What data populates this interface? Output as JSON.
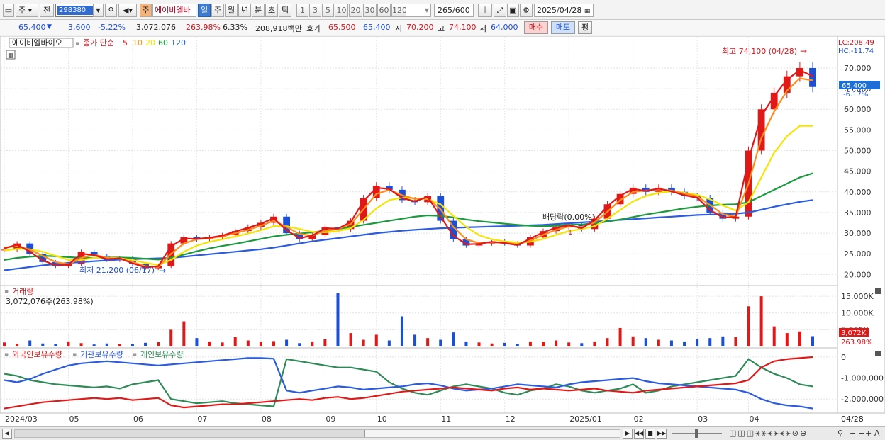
{
  "toolbar": {
    "market": "주",
    "prev_label": "전",
    "code": "298380",
    "stock_tag": "주",
    "stock_name": "에이비엘바",
    "periods": [
      "일",
      "주",
      "월",
      "년",
      "분",
      "초",
      "틱"
    ],
    "active_period": "일",
    "intervals": [
      "1",
      "3",
      "5",
      "10",
      "20",
      "30",
      "60",
      "120"
    ],
    "count": "265",
    "count_max": "/600",
    "date": "2025/04/28"
  },
  "quote": {
    "price": "65,400",
    "change": "3,600",
    "change_pct": "-5.22%",
    "volume": "3,072,076",
    "vol_ratio": "263.98%",
    "turnover_pct": "6.33%",
    "amount": "208,918백만",
    "bid_label": "호가",
    "ask_price": "65,500",
    "bid_price": "65,400",
    "open_label": "시",
    "open": "70,200",
    "high_label": "고",
    "high": "74,100",
    "low_label": "저",
    "low": "64,000",
    "buy_label": "매수",
    "sell_label": "매도",
    "flat_label": "평"
  },
  "price_panel": {
    "stock_label": "에이비엘바이오",
    "ma_title": "종가 단순",
    "ma_periods": [
      "5",
      "10",
      "20",
      "60",
      "120"
    ],
    "ma_colors": [
      "#e01818",
      "#ff8c1a",
      "#f5e400",
      "#1a9a3c",
      "#2a5be0"
    ],
    "lc": "LC:208.49",
    "hc": "HC:-11.74",
    "high_note": "최고 74,100 (04/28)",
    "low_note": "최저 21,200 (06/17)",
    "dividend_note": "배당락(0.00%)",
    "price_tag": "65,400",
    "pct_tag": "-6.17%",
    "y_labels": [
      "70,000",
      "65,000",
      "60,000",
      "55,000",
      "50,000",
      "45,000",
      "40,000",
      "35,000",
      "30,000",
      "25,000",
      "20,000"
    ]
  },
  "volume_panel": {
    "title": "거래량",
    "value": "3,072,076주(263.98%)",
    "y_labels": [
      "15,000K",
      "10,000K",
      "5,000K"
    ],
    "tag": "3,072K",
    "tag_pct": "263.98%"
  },
  "holding_panel": {
    "series_labels": [
      "외국인보유수량",
      "기관보유수량",
      "개인보유수량"
    ],
    "series_colors": [
      "#e01818",
      "#2a5be0",
      "#2e8b57"
    ],
    "y_labels": [
      "0",
      "-1,000,000",
      "-2,000,000"
    ]
  },
  "x_axis": {
    "labels": [
      "2024/03",
      "05",
      "06",
      "07",
      "08",
      "09",
      "10",
      "11",
      "12",
      "2025/01",
      "02",
      "03",
      "04"
    ],
    "right_label": "04/28"
  },
  "chart_data": {
    "type": "line",
    "title": "에이비엘바이오",
    "ylim": [
      18000,
      76000
    ],
    "months": [
      "2024/03",
      "05",
      "06",
      "07",
      "08",
      "09",
      "10",
      "11",
      "12",
      "2025/01",
      "02",
      "03",
      "04"
    ],
    "close": [
      26000,
      27500,
      25000,
      23000,
      22000,
      22500,
      25500,
      24500,
      23500,
      24000,
      22500,
      21500,
      22000,
      27500,
      29000,
      28500,
      29000,
      29500,
      30500,
      31500,
      32500,
      34000,
      30000,
      28500,
      29500,
      31500,
      31000,
      33000,
      38500,
      41500,
      40500,
      38000,
      37500,
      39000,
      33000,
      28500,
      27000,
      27500,
      28000,
      27500,
      27000,
      29000,
      30500,
      31500,
      32000,
      31000,
      33500,
      37000,
      39500,
      41000,
      40000,
      41000,
      40000,
      39000,
      38500,
      35000,
      33500,
      34000,
      50000,
      60000,
      64000,
      68000,
      70000,
      65400
    ],
    "series": [
      {
        "name": "5",
        "values": [
          26300,
          27200,
          25500,
          23400,
          22200,
          22400,
          25000,
          24700,
          23700,
          23900,
          22700,
          21700,
          22000,
          26800,
          28700,
          28600,
          28900,
          29400,
          30400,
          31300,
          32300,
          33600,
          30700,
          28800,
          29400,
          31200,
          31100,
          32700,
          37800,
          41000,
          40700,
          38500,
          37700,
          38800,
          34000,
          29400,
          27300,
          27400,
          27900,
          27600,
          27100,
          28700,
          30200,
          31300,
          31900,
          31200,
          33100,
          36500,
          39100,
          40700,
          40200,
          40800,
          40100,
          39200,
          38600,
          35600,
          33800,
          33900,
          47800,
          58400,
          63200,
          67200,
          69500,
          68000
        ]
      },
      {
        "name": "10",
        "values": [
          26500,
          26900,
          26000,
          24500,
          23000,
          22500,
          24000,
          24800,
          24000,
          23800,
          23000,
          22000,
          21800,
          25000,
          27500,
          28500,
          28800,
          29200,
          30000,
          30800,
          31800,
          33000,
          31500,
          29800,
          29400,
          30600,
          31000,
          32200,
          35800,
          39500,
          40500,
          39200,
          38300,
          38500,
          35800,
          31500,
          28500,
          27600,
          27800,
          27700,
          27300,
          28200,
          29600,
          30800,
          31600,
          31500,
          32600,
          35200,
          38000,
          40000,
          40300,
          40600,
          40300,
          39600,
          38900,
          36800,
          34600,
          34000,
          42000,
          53000,
          59500,
          64500,
          67500,
          67000
        ]
      },
      {
        "name": "20",
        "values": [
          25800,
          26200,
          26100,
          25500,
          24500,
          23500,
          23500,
          24000,
          24100,
          23900,
          23500,
          22800,
          22300,
          23500,
          25500,
          27000,
          27900,
          28500,
          29200,
          29900,
          30700,
          31700,
          31700,
          31000,
          30300,
          30200,
          30500,
          31200,
          33200,
          36000,
          38000,
          38600,
          38400,
          38300,
          37000,
          34200,
          31500,
          29500,
          28500,
          28000,
          27700,
          27900,
          28600,
          29600,
          30500,
          31000,
          31700,
          33500,
          35600,
          37700,
          39000,
          39800,
          40100,
          39800,
          39300,
          38200,
          36700,
          35500,
          37500,
          43500,
          49500,
          53500,
          56000,
          56000
        ]
      },
      {
        "name": "60",
        "values": [
          23500,
          24000,
          24300,
          24500,
          24400,
          24200,
          24000,
          24000,
          24100,
          24100,
          24000,
          23800,
          23600,
          24000,
          24800,
          25600,
          26300,
          26900,
          27400,
          28000,
          28600,
          29200,
          29600,
          29900,
          30200,
          30600,
          31000,
          31500,
          32000,
          32500,
          33000,
          33500,
          34000,
          34300,
          34200,
          33800,
          33300,
          32900,
          32600,
          32300,
          32000,
          31800,
          31700,
          31800,
          32000,
          32100,
          32400,
          32800,
          33300,
          33900,
          34500,
          35000,
          35500,
          36000,
          36400,
          36700,
          36900,
          37000,
          37500,
          39000,
          40500,
          42000,
          43500,
          44500
        ]
      },
      {
        "name": "120",
        "values": [
          21000,
          21400,
          21800,
          22200,
          22500,
          22800,
          23000,
          23200,
          23400,
          23600,
          23700,
          23800,
          23900,
          24000,
          24300,
          24600,
          24900,
          25200,
          25500,
          25800,
          26100,
          26500,
          27000,
          27500,
          28000,
          28400,
          28800,
          29200,
          29600,
          30000,
          30300,
          30600,
          30800,
          31000,
          31200,
          31300,
          31400,
          31500,
          31600,
          31700,
          31800,
          31900,
          32000,
          32200,
          32400,
          32600,
          32800,
          33000,
          33200,
          33400,
          33600,
          33800,
          34000,
          34200,
          34400,
          34500,
          34600,
          34700,
          35000,
          35700,
          36400,
          37000,
          37600,
          38000
        ]
      }
    ],
    "volume_k": [
      1200,
      800,
      1800,
      900,
      700,
      1500,
      1000,
      600,
      900,
      700,
      800,
      1100,
      1300,
      5000,
      7500,
      2500,
      1500,
      1200,
      2800,
      1800,
      1400,
      1600,
      2000,
      1000,
      1500,
      2200,
      16000,
      4000,
      2000,
      3500,
      1800,
      9000,
      3500,
      2500,
      2000,
      4200,
      1500,
      1200,
      900,
      1100,
      800,
      1500,
      1300,
      1800,
      1200,
      1000,
      1500,
      2500,
      5500,
      3000,
      2500,
      2000,
      1800,
      1500,
      2200,
      2500,
      3000,
      2800,
      12000,
      15000,
      6000,
      4000,
      4500,
      3072
    ],
    "foreign_holding": [
      -2450000,
      -2350000,
      -2250000,
      -2150000,
      -2100000,
      -2050000,
      -2000000,
      -1950000,
      -2000000,
      -1950000,
      -2050000,
      -2000000,
      -1950000,
      -2300000,
      -2400000,
      -2350000,
      -2300000,
      -2250000,
      -2250000,
      -2200000,
      -2150000,
      -2100000,
      -2050000,
      -2000000,
      -2050000,
      -1950000,
      -1900000,
      -2000000,
      -1950000,
      -1850000,
      -1750000,
      -1650000,
      -1600000,
      -1550000,
      -1500000,
      -1450000,
      -1500000,
      -1550000,
      -1600000,
      -1500000,
      -1450000,
      -1550000,
      -1500000,
      -1550000,
      -1600000,
      -1550000,
      -1500000,
      -1600000,
      -1650000,
      -1700000,
      -1600000,
      -1550000,
      -1500000,
      -1450000,
      -1400000,
      -1350000,
      -1300000,
      -1250000,
      -1100000,
      -500000,
      -200000,
      -100000,
      -50000,
      0
    ],
    "institution_holding": [
      -1100000,
      -1200000,
      -1050000,
      -800000,
      -600000,
      -400000,
      -300000,
      -250000,
      -200000,
      -250000,
      -300000,
      -350000,
      -400000,
      -350000,
      -300000,
      -250000,
      -200000,
      -150000,
      -100000,
      -50000,
      -50000,
      -80000,
      -1600000,
      -1700000,
      -1600000,
      -1500000,
      -1400000,
      -1450000,
      -1550000,
      -1500000,
      -1450000,
      -1400000,
      -1300000,
      -1250000,
      -1350000,
      -1500000,
      -1600000,
      -1550000,
      -1500000,
      -1400000,
      -1300000,
      -1350000,
      -1400000,
      -1450000,
      -1300000,
      -1200000,
      -1150000,
      -1100000,
      -1050000,
      -1000000,
      -1150000,
      -1250000,
      -1300000,
      -1350000,
      -1400000,
      -1450000,
      -1500000,
      -1550000,
      -1700000,
      -2000000,
      -2200000,
      -2300000,
      -2350000,
      -2450000
    ],
    "individual_holding": [
      -800000,
      -900000,
      -1100000,
      -1200000,
      -1300000,
      -1350000,
      -1400000,
      -1450000,
      -1400000,
      -1500000,
      -1300000,
      -1200000,
      -1100000,
      -2000000,
      -2100000,
      -2200000,
      -2150000,
      -2100000,
      -2200000,
      -2250000,
      -2300000,
      -2350000,
      -100000,
      -200000,
      -300000,
      -400000,
      -500000,
      -500000,
      -600000,
      -700000,
      -1200000,
      -1500000,
      -1700000,
      -1800000,
      -1600000,
      -1400000,
      -1300000,
      -1400000,
      -1500000,
      -1700000,
      -1800000,
      -1600000,
      -1500000,
      -1300000,
      -1400000,
      -1600000,
      -1700000,
      -1600000,
      -1500000,
      -1300000,
      -1700000,
      -1600000,
      -1400000,
      -1300000,
      -1200000,
      -1100000,
      -1000000,
      -900000,
      -100000,
      -500000,
      -800000,
      -1000000,
      -1300000,
      -1400000
    ]
  }
}
